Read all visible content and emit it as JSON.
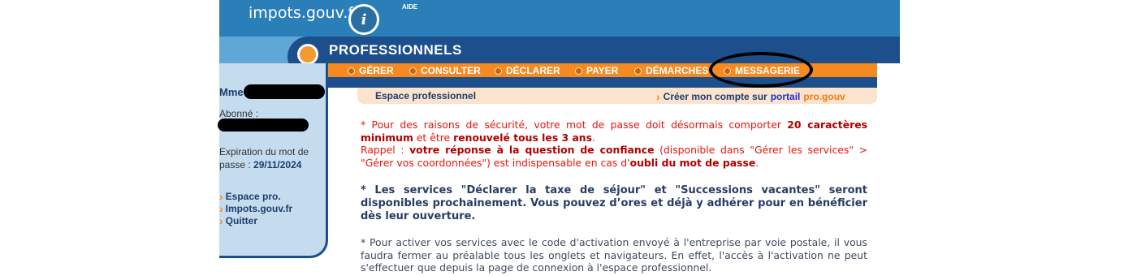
{
  "header": {
    "logo": "impots.gouv.fr",
    "badge_letter": "i",
    "aide": "AIDE",
    "section_title": "PROFESSIONNELS"
  },
  "nav": {
    "items": [
      {
        "label": "GÉRER"
      },
      {
        "label": "CONSULTER"
      },
      {
        "label": "DÉCLARER"
      },
      {
        "label": "PAYER"
      },
      {
        "label": "DÉMARCHES"
      },
      {
        "label": "MESSAGERIE"
      }
    ]
  },
  "sidebar": {
    "title_prefix": "Mme",
    "abonne_label": "Abonné :",
    "expiration_line1": "Expiration du mot de",
    "expiration_line2": "passe : ",
    "expiration_date": "29/11/2024",
    "links": [
      {
        "label": "Espace pro."
      },
      {
        "label": "Impots.gouv.fr"
      },
      {
        "label": "Quitter"
      }
    ]
  },
  "infobar": {
    "espace": "Espace professionnel",
    "creer": "Créer mon compte sur ",
    "portail_a": "portail",
    "portail_b": "pro.gouv"
  },
  "messages": {
    "m1_a": "* Pour des raisons de sécurité, votre mot de passe doit désormais comporter ",
    "m1_b": "20 caractères minimum",
    "m1_c": " et être ",
    "m1_d": "renouvelé tous les 3 ans",
    "m1_e": ".",
    "m1_f": "Rappel : ",
    "m1_g": "votre réponse à la question de confiance",
    "m1_h": " (disponible dans \"Gérer les services\" > \"Gérer vos coordonnées\") est indispensable en cas d'",
    "m1_i": "oubli du mot de passe",
    "m1_j": ".",
    "m2": "* Les services \"Déclarer la taxe de séjour\" et \"Successions vacantes\" seront disponibles prochainement. Vous pouvez d’ores et déjà y adhérer pour en bénéficier dès leur ouverture.",
    "m3": "* Pour activer vos services avec le code d'activation envoyé à l'entreprise par voie postale, il vous faudra fermer au préalable tous les onglets et navigateurs. En effet, l'accès à l'activation ne peut s'effectuer que depuis la page de connexion à l'espace professionnel."
  }
}
